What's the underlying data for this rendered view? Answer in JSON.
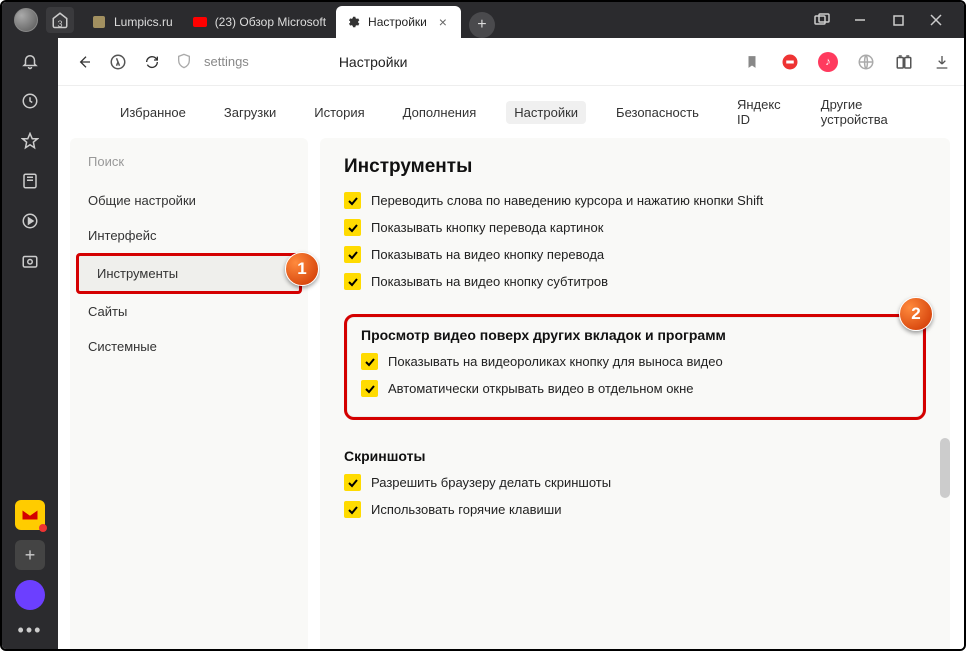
{
  "titlebar": {
    "home_badge": "3",
    "tabs": [
      {
        "icon_bg": "#b22",
        "label": "Lumpics.ru"
      },
      {
        "icon_bg": "#f00",
        "label": "(23) Обзор Microsoft"
      },
      {
        "icon_bg": "#555",
        "label": "Настройки"
      }
    ],
    "active_tab_index": 2
  },
  "addressbar": {
    "url_text": "settings",
    "page_title": "Настройки"
  },
  "category_nav": {
    "items": [
      "Избранное",
      "Загрузки",
      "История",
      "Дополнения",
      "Настройки",
      "Безопасность",
      "Яндекс ID",
      "Другие устройства"
    ],
    "active_index": 4
  },
  "sidebar": {
    "search_placeholder": "Поиск",
    "items": [
      "Общие настройки",
      "Интерфейс",
      "Инструменты",
      "Сайты",
      "Системные"
    ],
    "highlighted_index": 2
  },
  "settings": {
    "main_title": "Инструменты",
    "checks_top": [
      "Переводить слова по наведению курсора и нажатию кнопки Shift",
      "Показывать кнопку перевода картинок",
      "Показывать на видео кнопку перевода",
      "Показывать на видео кнопку субтитров"
    ],
    "pip": {
      "title": "Просмотр видео поверх других вкладок и программ",
      "checks": [
        "Показывать на видеороликах кнопку для выноса видео",
        "Автоматически открывать видео в отдельном окне"
      ]
    },
    "screenshots": {
      "title": "Скриншоты",
      "checks": [
        "Разрешить браузеру делать скриншоты",
        "Использовать горячие клавиши"
      ]
    }
  },
  "callouts": {
    "one": "1",
    "two": "2"
  }
}
